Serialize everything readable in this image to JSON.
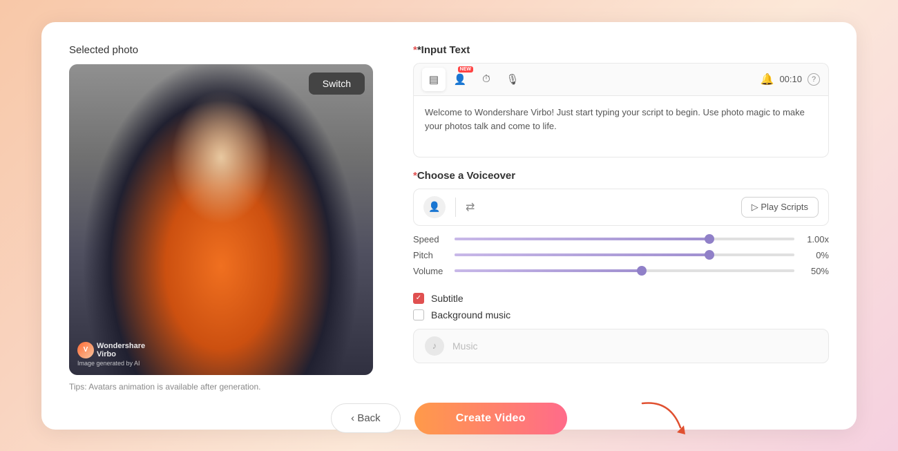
{
  "page": {
    "background": "gradient peach-pink"
  },
  "left_panel": {
    "title": "Selected photo",
    "switch_label": "Switch",
    "watermark": {
      "brand": "Wondershare",
      "product": "Virbo",
      "sub": "Image generated by AI"
    },
    "tips": "Tips: Avatars animation is available after generation."
  },
  "right_panel": {
    "input_text_label": "*Input Text",
    "toolbar": {
      "buttons": [
        {
          "id": "text-icon",
          "glyph": "▤",
          "new_badge": false,
          "active": true
        },
        {
          "id": "person-icon",
          "glyph": "👤",
          "new_badge": true,
          "active": false
        },
        {
          "id": "clock-icon",
          "glyph": "⏱",
          "new_badge": false,
          "active": false
        },
        {
          "id": "mic-icon",
          "glyph": "🎙",
          "new_badge": false,
          "active": false
        }
      ],
      "bell_icon": "🔔",
      "time": "00:10",
      "help": "?"
    },
    "text_content": "Welcome to Wondershare Virbo! Just start typing your script to begin. Use photo magic to make your photos talk and come to life.",
    "voiceover_label": "*Choose a Voiceover",
    "play_scripts_label": "▷ Play Scripts",
    "sliders": [
      {
        "label": "Speed",
        "value": "1.00x",
        "fill_pct": 75
      },
      {
        "label": "Pitch",
        "value": "0%",
        "fill_pct": 75
      },
      {
        "label": "Volume",
        "value": "50%",
        "fill_pct": 55
      }
    ],
    "subtitle_label": "Subtitle",
    "subtitle_checked": true,
    "background_music_label": "Background music",
    "background_music_checked": false,
    "music_placeholder": "Music"
  },
  "bottom": {
    "back_label": "‹ Back",
    "create_label": "Create Video"
  }
}
